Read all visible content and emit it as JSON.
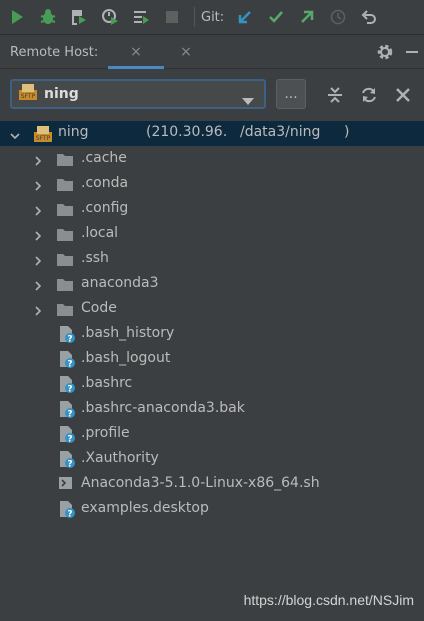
{
  "toolbar": {
    "git_label": "Git:",
    "icons": [
      "run-icon",
      "debug-icon",
      "coverage-icon",
      "profile-icon",
      "run-list-icon",
      "stop-icon",
      "git-update-icon",
      "git-commit-icon",
      "git-push-icon",
      "history-icon",
      "revert-icon"
    ]
  },
  "panel": {
    "title": "Remote Host:",
    "tab_close": "×"
  },
  "selector": {
    "value": "ning",
    "icon_text": "SFTP",
    "browse_label": "..."
  },
  "tree": {
    "root": {
      "name": "ning",
      "host": "(210.30.96.",
      "path": "/data3/ning",
      "suffix": ")"
    },
    "folders": [
      ".cache",
      ".conda",
      ".config",
      ".local",
      ".ssh",
      "anaconda3",
      "Code"
    ],
    "files": [
      {
        "name": ".bash_history",
        "icon": "unknown-file-icon"
      },
      {
        "name": ".bash_logout",
        "icon": "unknown-file-icon"
      },
      {
        "name": ".bashrc",
        "icon": "unknown-file-icon"
      },
      {
        "name": ".bashrc-anaconda3.bak",
        "icon": "unknown-file-icon"
      },
      {
        "name": ".profile",
        "icon": "unknown-file-icon"
      },
      {
        "name": ".Xauthority",
        "icon": "unknown-file-icon"
      },
      {
        "name": "Anaconda3-5.1.0-Linux-x86_64.sh",
        "icon": "shell-script-icon"
      },
      {
        "name": "examples.desktop",
        "icon": "unknown-file-icon"
      }
    ]
  },
  "watermark": "https://blog.csdn.net/NSJim",
  "colors": {
    "background": "#3c3f41",
    "selection": "#0d293e",
    "accent": "#4a88c7",
    "run_green": "#499c54",
    "git_blue": "#3592c4",
    "git_green": "#59a869"
  }
}
